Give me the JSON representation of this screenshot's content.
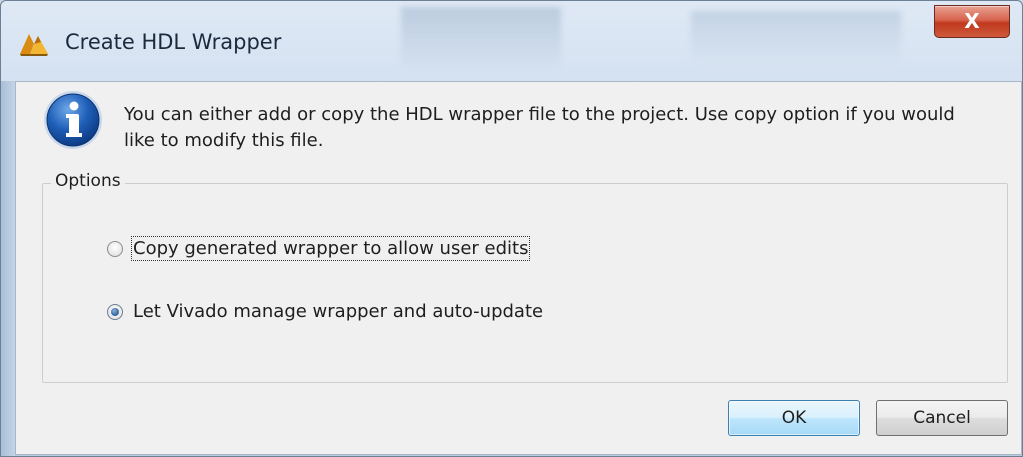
{
  "window": {
    "title": "Create HDL Wrapper",
    "close_label": "X",
    "app_icon": "vivado-logo-icon"
  },
  "message": {
    "icon": "info-icon",
    "text": "You can either add or copy the HDL wrapper file to the project. Use copy option if you would like to modify this file."
  },
  "options": {
    "legend": "Options",
    "items": [
      {
        "label": "Copy generated wrapper to allow user edits",
        "selected": false
      },
      {
        "label": "Let Vivado manage wrapper and auto-update",
        "selected": true
      }
    ]
  },
  "buttons": {
    "ok_label": "OK",
    "cancel_label": "Cancel"
  }
}
